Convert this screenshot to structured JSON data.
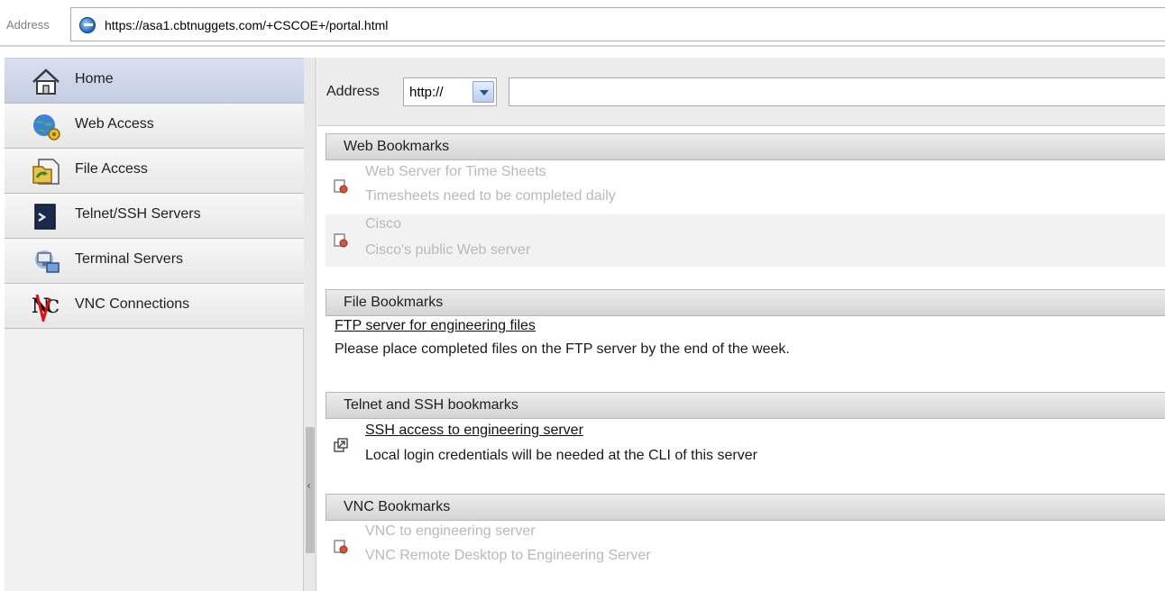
{
  "browser": {
    "address_label": "Address",
    "url": "https://asa1.cbtnuggets.com/+CSCOE+/portal.html"
  },
  "sidebar": {
    "items": [
      {
        "label": "Home",
        "icon": "home-icon",
        "active": true
      },
      {
        "label": "Web Access",
        "icon": "web-access-icon"
      },
      {
        "label": "File Access",
        "icon": "file-access-icon"
      },
      {
        "label": "Telnet/SSH Servers",
        "icon": "terminal-icon"
      },
      {
        "label": "Terminal Servers",
        "icon": "terminal-servers-icon"
      },
      {
        "label": "VNC Connections",
        "icon": "vnc-icon"
      }
    ]
  },
  "main": {
    "address_label": "Address",
    "protocol_value": "http://",
    "url_value": "",
    "sections": {
      "web": {
        "title": "Web Bookmarks",
        "items": [
          {
            "title": "Web Server for Time Sheets",
            "desc": "Timesheets need to be completed daily"
          },
          {
            "title": "Cisco",
            "desc": "Cisco's public Web server"
          }
        ]
      },
      "file": {
        "title": "File Bookmarks",
        "items": [
          {
            "title": "FTP server for engineering files",
            "desc": "Please place completed files on the FTP server by the end of the week."
          }
        ]
      },
      "telnet": {
        "title": "Telnet and SSH bookmarks",
        "items": [
          {
            "title": "SSH access to engineering server",
            "desc": "Local login credentials will be needed at the CLI of this server"
          }
        ]
      },
      "vnc": {
        "title": "VNC Bookmarks",
        "items": [
          {
            "title": "VNC to engineering server",
            "desc": "VNC Remote Desktop to Engineering Server"
          }
        ]
      }
    }
  }
}
